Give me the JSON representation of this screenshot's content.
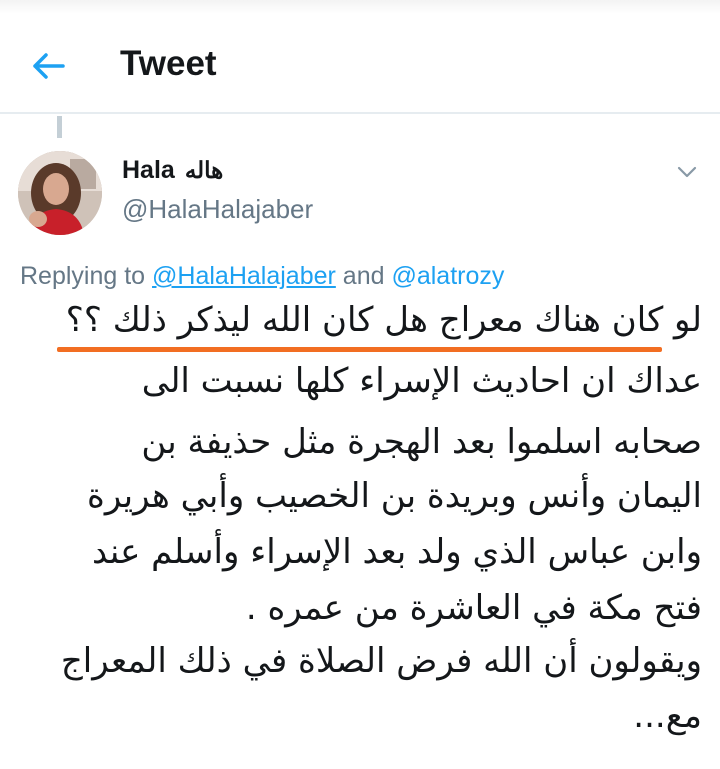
{
  "header": {
    "title": "Tweet"
  },
  "tweet": {
    "author": {
      "name": "Hala",
      "name_ar": "هاله",
      "handle": "@HalaHalajaber"
    },
    "replying": {
      "prefix": "Replying to",
      "mention1": "@HalaHalajaber",
      "conjunction": "and",
      "mention2": "@alatrozy"
    },
    "lines": [
      "لو كان هناك معراج هل كان الله ليذكر ذلك ؟؟",
      "عداك ان احاديث الإسراء كلها نسبت الى",
      "صحابه اسلموا بعد الهجرة مثل حذيفة بن",
      "اليمان وأنس وبريدة بن الخصيب وأبي هريرة",
      "وابن عباس الذي ولد بعد الإسراء وأسلم عند",
      "فتح مكة في العاشرة من عمره .",
      "ويقولون أن الله فرض الصلاة في ذلك المعراج",
      "مع..."
    ]
  },
  "colors": {
    "accent": "#1da1f2",
    "secondary_text": "#657786",
    "highlight": "#f26e22"
  }
}
